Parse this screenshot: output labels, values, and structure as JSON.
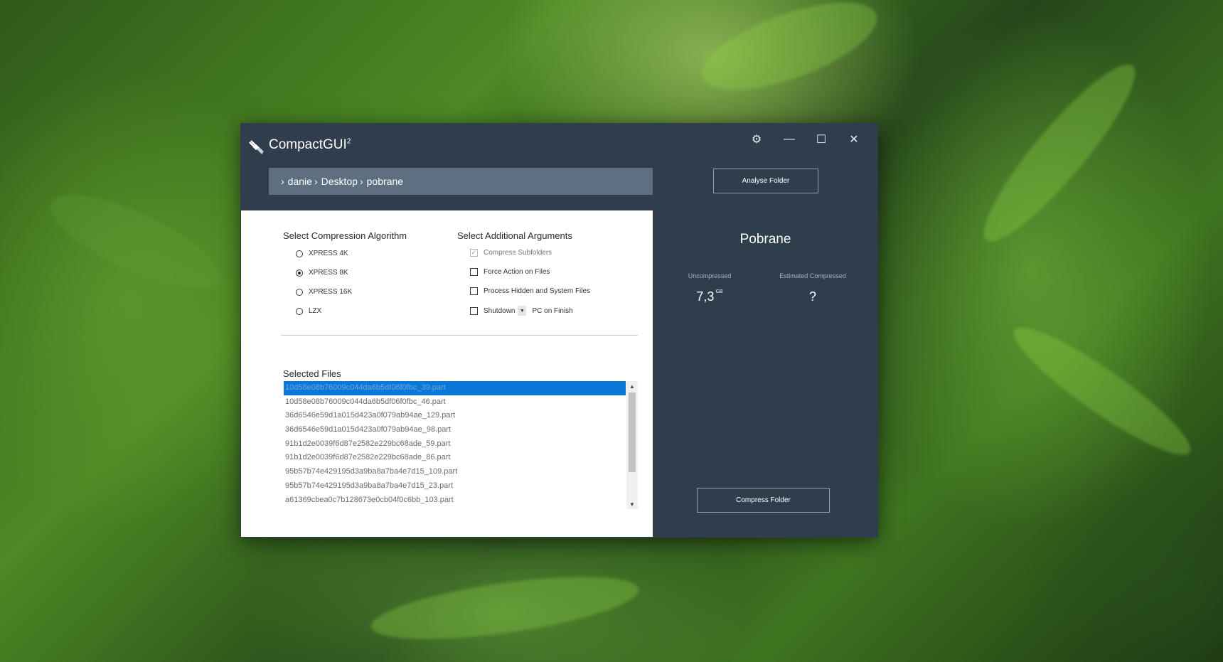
{
  "window": {
    "title": "CompactGUI",
    "title_superscript": "2",
    "controls": {
      "settings": "⚙",
      "minimize": "—",
      "maximize": "☐",
      "close": "✕"
    }
  },
  "path": {
    "segments": [
      "danie",
      "Desktop",
      "pobrane"
    ]
  },
  "buttons": {
    "analyse": "Analyse Folder",
    "compress": "Compress Folder"
  },
  "algorithm": {
    "heading": "Select Compression Algorithm",
    "options": [
      {
        "label": "XPRESS 4K",
        "selected": false
      },
      {
        "label": "XPRESS 8K",
        "selected": true
      },
      {
        "label": "XPRESS 16K",
        "selected": false
      },
      {
        "label": "LZX",
        "selected": false
      }
    ]
  },
  "arguments": {
    "heading": "Select Additional Arguments",
    "compress_subfolders": "Compress Subfolders",
    "force_action": "Force Action on Files",
    "process_hidden": "Process Hidden and System Files",
    "shutdown": "Shutdown",
    "shutdown_suffix": "PC on Finish"
  },
  "files": {
    "heading": "Selected Files",
    "items": [
      "10d58e08b76009c044da6b5df06f0fbc_39.part",
      "10d58e08b76009c044da6b5df06f0fbc_46.part",
      "36d6546e59d1a015d423a0f079ab94ae_129.part",
      "36d6546e59d1a015d423a0f079ab94ae_98.part",
      "91b1d2e0039f6d87e2582e229bc68ade_59.part",
      "91b1d2e0039f6d87e2582e229bc68ade_86.part",
      "95b57b74e429195d3a9ba8a7ba4e7d15_109.part",
      "95b57b74e429195d3a9ba8a7ba4e7d15_23.part",
      "a61369cbea0c7b128673e0cb04f0c6bb_103.part"
    ]
  },
  "summary": {
    "folder_name": "Pobrane",
    "uncompressed_label": "Uncompressed",
    "uncompressed_value": "7,3",
    "uncompressed_unit": "GB",
    "estimated_label": "Estimated Compressed",
    "estimated_value": "?"
  },
  "colors": {
    "window_bg": "#2f3d4c",
    "path_bg": "#5d6f80",
    "selection": "#0a78d7"
  }
}
